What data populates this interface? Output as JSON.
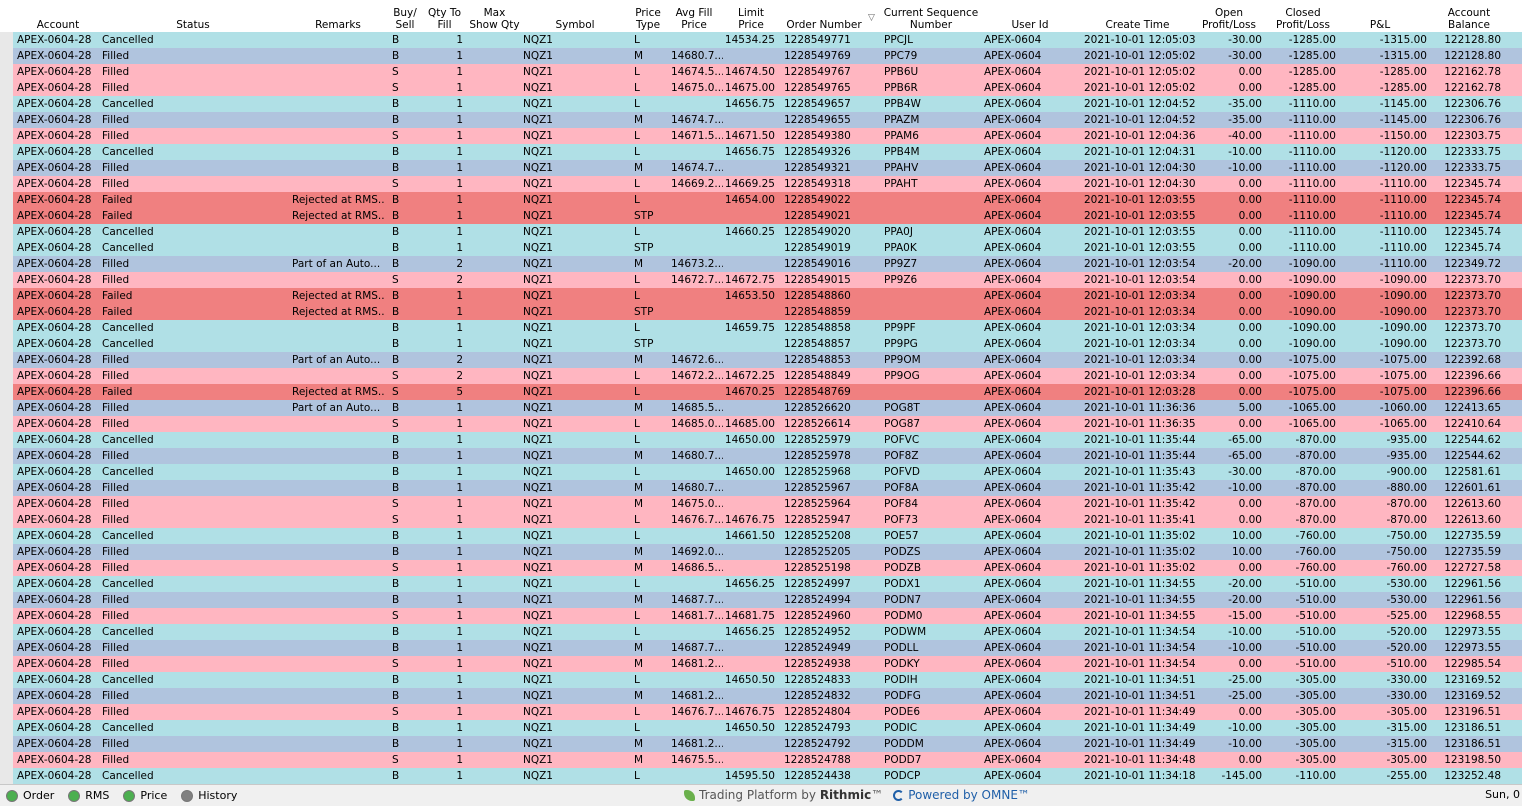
{
  "columns": {
    "account": "Account",
    "status": "Status",
    "remarks": "Remarks",
    "buy_sell": "Buy/\nSell",
    "qty_to_fill": "Qty To\nFill",
    "max_show_qty": "Max\nShow Qty",
    "symbol": "Symbol",
    "price_type": "Price\nType",
    "avg_fill_price": "Avg Fill\nPrice",
    "limit_price": "Limit\nPrice",
    "order_number": "Order Number",
    "current_sequence_number": "Current Sequence\nNumber",
    "user_id": "User Id",
    "create_time": "Create Time",
    "open_pl": "Open\nProfit/Loss",
    "closed_pl": "Closed\nProfit/Loss",
    "pl": "P&L",
    "account_balance": "Account\nBalance"
  },
  "sort_indicator": "▽",
  "rows": [
    [
      "APEX-0604-28",
      "Cancelled",
      "",
      "B",
      "1",
      "NQZ1",
      "L",
      "",
      "14534.25",
      "1228549771",
      "PPCJL",
      "APEX-0604",
      "2021-10-01 12:05:03",
      "-30.00",
      "-1285.00",
      "-1315.00",
      "122128.80"
    ],
    [
      "APEX-0604-28",
      "Filled",
      "",
      "B",
      "1",
      "NQZ1",
      "M",
      "14680.7...",
      "",
      "1228549769",
      "PPC79",
      "APEX-0604",
      "2021-10-01 12:05:02",
      "-30.00",
      "-1285.00",
      "-1315.00",
      "122128.80"
    ],
    [
      "APEX-0604-28",
      "Filled",
      "",
      "S",
      "1",
      "NQZ1",
      "L",
      "14674.5...",
      "14674.50",
      "1228549767",
      "PPB6U",
      "APEX-0604",
      "2021-10-01 12:05:02",
      "0.00",
      "-1285.00",
      "-1285.00",
      "122162.78"
    ],
    [
      "APEX-0604-28",
      "Filled",
      "",
      "S",
      "1",
      "NQZ1",
      "L",
      "14675.0...",
      "14675.00",
      "1228549765",
      "PPB6R",
      "APEX-0604",
      "2021-10-01 12:05:02",
      "0.00",
      "-1285.00",
      "-1285.00",
      "122162.78"
    ],
    [
      "APEX-0604-28",
      "Cancelled",
      "",
      "B",
      "1",
      "NQZ1",
      "L",
      "",
      "14656.75",
      "1228549657",
      "PPB4W",
      "APEX-0604",
      "2021-10-01 12:04:52",
      "-35.00",
      "-1110.00",
      "-1145.00",
      "122306.76"
    ],
    [
      "APEX-0604-28",
      "Filled",
      "",
      "B",
      "1",
      "NQZ1",
      "M",
      "14674.7...",
      "",
      "1228549655",
      "PPAZM",
      "APEX-0604",
      "2021-10-01 12:04:52",
      "-35.00",
      "-1110.00",
      "-1145.00",
      "122306.76"
    ],
    [
      "APEX-0604-28",
      "Filled",
      "",
      "S",
      "1",
      "NQZ1",
      "L",
      "14671.5...",
      "14671.50",
      "1228549380",
      "PPAM6",
      "APEX-0604",
      "2021-10-01 12:04:36",
      "-40.00",
      "-1110.00",
      "-1150.00",
      "122303.75"
    ],
    [
      "APEX-0604-28",
      "Cancelled",
      "",
      "B",
      "1",
      "NQZ1",
      "L",
      "",
      "14656.75",
      "1228549326",
      "PPB4M",
      "APEX-0604",
      "2021-10-01 12:04:31",
      "-10.00",
      "-1110.00",
      "-1120.00",
      "122333.75"
    ],
    [
      "APEX-0604-28",
      "Filled",
      "",
      "B",
      "1",
      "NQZ1",
      "M",
      "14674.7...",
      "",
      "1228549321",
      "PPAHV",
      "APEX-0604",
      "2021-10-01 12:04:30",
      "-10.00",
      "-1110.00",
      "-1120.00",
      "122333.75"
    ],
    [
      "APEX-0604-28",
      "Filled",
      "",
      "S",
      "1",
      "NQZ1",
      "L",
      "14669.2...",
      "14669.25",
      "1228549318",
      "PPAHT",
      "APEX-0604",
      "2021-10-01 12:04:30",
      "0.00",
      "-1110.00",
      "-1110.00",
      "122345.74"
    ],
    [
      "APEX-0604-28",
      "Failed",
      "Rejected at RMS...",
      "B",
      "1",
      "NQZ1",
      "L",
      "",
      "14654.00",
      "1228549022",
      "",
      "APEX-0604",
      "2021-10-01 12:03:55",
      "0.00",
      "-1110.00",
      "-1110.00",
      "122345.74"
    ],
    [
      "APEX-0604-28",
      "Failed",
      "Rejected at RMS...",
      "B",
      "1",
      "NQZ1",
      "STP",
      "",
      "",
      "1228549021",
      "",
      "APEX-0604",
      "2021-10-01 12:03:55",
      "0.00",
      "-1110.00",
      "-1110.00",
      "122345.74"
    ],
    [
      "APEX-0604-28",
      "Cancelled",
      "",
      "B",
      "1",
      "NQZ1",
      "L",
      "",
      "14660.25",
      "1228549020",
      "PPA0J",
      "APEX-0604",
      "2021-10-01 12:03:55",
      "0.00",
      "-1110.00",
      "-1110.00",
      "122345.74"
    ],
    [
      "APEX-0604-28",
      "Cancelled",
      "",
      "B",
      "1",
      "NQZ1",
      "STP",
      "",
      "",
      "1228549019",
      "PPA0K",
      "APEX-0604",
      "2021-10-01 12:03:55",
      "0.00",
      "-1110.00",
      "-1110.00",
      "122345.74"
    ],
    [
      "APEX-0604-28",
      "Filled",
      "Part of an Auto...",
      "B",
      "2",
      "NQZ1",
      "M",
      "14673.2...",
      "",
      "1228549016",
      "PP9Z7",
      "APEX-0604",
      "2021-10-01 12:03:54",
      "-20.00",
      "-1090.00",
      "-1110.00",
      "122349.72"
    ],
    [
      "APEX-0604-28",
      "Filled",
      "",
      "S",
      "2",
      "NQZ1",
      "L",
      "14672.7...",
      "14672.75",
      "1228549015",
      "PP9Z6",
      "APEX-0604",
      "2021-10-01 12:03:54",
      "0.00",
      "-1090.00",
      "-1090.00",
      "122373.70"
    ],
    [
      "APEX-0604-28",
      "Failed",
      "Rejected at RMS...",
      "B",
      "1",
      "NQZ1",
      "L",
      "",
      "14653.50",
      "1228548860",
      "",
      "APEX-0604",
      "2021-10-01 12:03:34",
      "0.00",
      "-1090.00",
      "-1090.00",
      "122373.70"
    ],
    [
      "APEX-0604-28",
      "Failed",
      "Rejected at RMS...",
      "B",
      "1",
      "NQZ1",
      "STP",
      "",
      "",
      "1228548859",
      "",
      "APEX-0604",
      "2021-10-01 12:03:34",
      "0.00",
      "-1090.00",
      "-1090.00",
      "122373.70"
    ],
    [
      "APEX-0604-28",
      "Cancelled",
      "",
      "B",
      "1",
      "NQZ1",
      "L",
      "",
      "14659.75",
      "1228548858",
      "PP9PF",
      "APEX-0604",
      "2021-10-01 12:03:34",
      "0.00",
      "-1090.00",
      "-1090.00",
      "122373.70"
    ],
    [
      "APEX-0604-28",
      "Cancelled",
      "",
      "B",
      "1",
      "NQZ1",
      "STP",
      "",
      "",
      "1228548857",
      "PP9PG",
      "APEX-0604",
      "2021-10-01 12:03:34",
      "0.00",
      "-1090.00",
      "-1090.00",
      "122373.70"
    ],
    [
      "APEX-0604-28",
      "Filled",
      "Part of an Auto...",
      "B",
      "2",
      "NQZ1",
      "M",
      "14672.6...",
      "",
      "1228548853",
      "PP9OM",
      "APEX-0604",
      "2021-10-01 12:03:34",
      "0.00",
      "-1075.00",
      "-1075.00",
      "122392.68"
    ],
    [
      "APEX-0604-28",
      "Filled",
      "",
      "S",
      "2",
      "NQZ1",
      "L",
      "14672.2...",
      "14672.25",
      "1228548849",
      "PP9OG",
      "APEX-0604",
      "2021-10-01 12:03:34",
      "0.00",
      "-1075.00",
      "-1075.00",
      "122396.66"
    ],
    [
      "APEX-0604-28",
      "Failed",
      "Rejected at RMS...",
      "S",
      "5",
      "NQZ1",
      "L",
      "",
      "14670.25",
      "1228548769",
      "",
      "APEX-0604",
      "2021-10-01 12:03:28",
      "0.00",
      "-1075.00",
      "-1075.00",
      "122396.66"
    ],
    [
      "APEX-0604-28",
      "Filled",
      "Part of an Auto...",
      "B",
      "1",
      "NQZ1",
      "M",
      "14685.5...",
      "",
      "1228526620",
      "POG8T",
      "APEX-0604",
      "2021-10-01 11:36:36",
      "5.00",
      "-1065.00",
      "-1060.00",
      "122413.65"
    ],
    [
      "APEX-0604-28",
      "Filled",
      "",
      "S",
      "1",
      "NQZ1",
      "L",
      "14685.0...",
      "14685.00",
      "1228526614",
      "POG87",
      "APEX-0604",
      "2021-10-01 11:36:35",
      "0.00",
      "-1065.00",
      "-1065.00",
      "122410.64"
    ],
    [
      "APEX-0604-28",
      "Cancelled",
      "",
      "B",
      "1",
      "NQZ1",
      "L",
      "",
      "14650.00",
      "1228525979",
      "POFVC",
      "APEX-0604",
      "2021-10-01 11:35:44",
      "-65.00",
      "-870.00",
      "-935.00",
      "122544.62"
    ],
    [
      "APEX-0604-28",
      "Filled",
      "",
      "B",
      "1",
      "NQZ1",
      "M",
      "14680.7...",
      "",
      "1228525978",
      "POF8Z",
      "APEX-0604",
      "2021-10-01 11:35:44",
      "-65.00",
      "-870.00",
      "-935.00",
      "122544.62"
    ],
    [
      "APEX-0604-28",
      "Cancelled",
      "",
      "B",
      "1",
      "NQZ1",
      "L",
      "",
      "14650.00",
      "1228525968",
      "POFVD",
      "APEX-0604",
      "2021-10-01 11:35:43",
      "-30.00",
      "-870.00",
      "-900.00",
      "122581.61"
    ],
    [
      "APEX-0604-28",
      "Filled",
      "",
      "B",
      "1",
      "NQZ1",
      "M",
      "14680.7...",
      "",
      "1228525967",
      "POF8A",
      "APEX-0604",
      "2021-10-01 11:35:42",
      "-10.00",
      "-870.00",
      "-880.00",
      "122601.61"
    ],
    [
      "APEX-0604-28",
      "Filled",
      "",
      "S",
      "1",
      "NQZ1",
      "M",
      "14675.0...",
      "",
      "1228525964",
      "POF84",
      "APEX-0604",
      "2021-10-01 11:35:42",
      "0.00",
      "-870.00",
      "-870.00",
      "122613.60"
    ],
    [
      "APEX-0604-28",
      "Filled",
      "",
      "S",
      "1",
      "NQZ1",
      "L",
      "14676.7...",
      "14676.75",
      "1228525947",
      "POF73",
      "APEX-0604",
      "2021-10-01 11:35:41",
      "0.00",
      "-870.00",
      "-870.00",
      "122613.60"
    ],
    [
      "APEX-0604-28",
      "Cancelled",
      "",
      "B",
      "1",
      "NQZ1",
      "L",
      "",
      "14661.50",
      "1228525208",
      "POE57",
      "APEX-0604",
      "2021-10-01 11:35:02",
      "10.00",
      "-760.00",
      "-750.00",
      "122735.59"
    ],
    [
      "APEX-0604-28",
      "Filled",
      "",
      "B",
      "1",
      "NQZ1",
      "M",
      "14692.0...",
      "",
      "1228525205",
      "PODZS",
      "APEX-0604",
      "2021-10-01 11:35:02",
      "10.00",
      "-760.00",
      "-750.00",
      "122735.59"
    ],
    [
      "APEX-0604-28",
      "Filled",
      "",
      "S",
      "1",
      "NQZ1",
      "M",
      "14686.5...",
      "",
      "1228525198",
      "PODZB",
      "APEX-0604",
      "2021-10-01 11:35:02",
      "0.00",
      "-760.00",
      "-760.00",
      "122727.58"
    ],
    [
      "APEX-0604-28",
      "Cancelled",
      "",
      "B",
      "1",
      "NQZ1",
      "L",
      "",
      "14656.25",
      "1228524997",
      "PODX1",
      "APEX-0604",
      "2021-10-01 11:34:55",
      "-20.00",
      "-510.00",
      "-530.00",
      "122961.56"
    ],
    [
      "APEX-0604-28",
      "Filled",
      "",
      "B",
      "1",
      "NQZ1",
      "M",
      "14687.7...",
      "",
      "1228524994",
      "PODN7",
      "APEX-0604",
      "2021-10-01 11:34:55",
      "-20.00",
      "-510.00",
      "-530.00",
      "122961.56"
    ],
    [
      "APEX-0604-28",
      "Filled",
      "",
      "S",
      "1",
      "NQZ1",
      "L",
      "14681.7...",
      "14681.75",
      "1228524960",
      "PODM0",
      "APEX-0604",
      "2021-10-01 11:34:55",
      "-15.00",
      "-510.00",
      "-525.00",
      "122968.55"
    ],
    [
      "APEX-0604-28",
      "Cancelled",
      "",
      "B",
      "1",
      "NQZ1",
      "L",
      "",
      "14656.25",
      "1228524952",
      "PODWM",
      "APEX-0604",
      "2021-10-01 11:34:54",
      "-10.00",
      "-510.00",
      "-520.00",
      "122973.55"
    ],
    [
      "APEX-0604-28",
      "Filled",
      "",
      "B",
      "1",
      "NQZ1",
      "M",
      "14687.7...",
      "",
      "1228524949",
      "PODLL",
      "APEX-0604",
      "2021-10-01 11:34:54",
      "-10.00",
      "-510.00",
      "-520.00",
      "122973.55"
    ],
    [
      "APEX-0604-28",
      "Filled",
      "",
      "S",
      "1",
      "NQZ1",
      "M",
      "14681.2...",
      "",
      "1228524938",
      "PODKY",
      "APEX-0604",
      "2021-10-01 11:34:54",
      "0.00",
      "-510.00",
      "-510.00",
      "122985.54"
    ],
    [
      "APEX-0604-28",
      "Cancelled",
      "",
      "B",
      "1",
      "NQZ1",
      "L",
      "",
      "14650.50",
      "1228524833",
      "PODIH",
      "APEX-0604",
      "2021-10-01 11:34:51",
      "-25.00",
      "-305.00",
      "-330.00",
      "123169.52"
    ],
    [
      "APEX-0604-28",
      "Filled",
      "",
      "B",
      "1",
      "NQZ1",
      "M",
      "14681.2...",
      "",
      "1228524832",
      "PODFG",
      "APEX-0604",
      "2021-10-01 11:34:51",
      "-25.00",
      "-305.00",
      "-330.00",
      "123169.52"
    ],
    [
      "APEX-0604-28",
      "Filled",
      "",
      "S",
      "1",
      "NQZ1",
      "L",
      "14676.7...",
      "14676.75",
      "1228524804",
      "PODE6",
      "APEX-0604",
      "2021-10-01 11:34:49",
      "0.00",
      "-305.00",
      "-305.00",
      "123196.51"
    ],
    [
      "APEX-0604-28",
      "Cancelled",
      "",
      "B",
      "1",
      "NQZ1",
      "L",
      "",
      "14650.50",
      "1228524793",
      "PODIC",
      "APEX-0604",
      "2021-10-01 11:34:49",
      "-10.00",
      "-305.00",
      "-315.00",
      "123186.51"
    ],
    [
      "APEX-0604-28",
      "Filled",
      "",
      "B",
      "1",
      "NQZ1",
      "M",
      "14681.2...",
      "",
      "1228524792",
      "PODDM",
      "APEX-0604",
      "2021-10-01 11:34:49",
      "-10.00",
      "-305.00",
      "-315.00",
      "123186.51"
    ],
    [
      "APEX-0604-28",
      "Filled",
      "",
      "S",
      "1",
      "NQZ1",
      "M",
      "14675.5...",
      "",
      "1228524788",
      "PODD7",
      "APEX-0604",
      "2021-10-01 11:34:48",
      "0.00",
      "-305.00",
      "-305.00",
      "123198.50"
    ],
    [
      "APEX-0604-28",
      "Cancelled",
      "",
      "B",
      "1",
      "NQZ1",
      "L",
      "",
      "14595.50",
      "1228524438",
      "PODCP",
      "APEX-0604",
      "2021-10-01 11:34:18",
      "-145.00",
      "-110.00",
      "-255.00",
      "123252.48"
    ]
  ],
  "status_colors": {
    "cancelled": "#b0e0e6",
    "filled_buy": "#b0c4de",
    "filled_sell": "#ffb6c1",
    "failed": "#f08080"
  },
  "statusbar": {
    "items": [
      {
        "label": "Order",
        "led_color": "#4caf50",
        "icon": "status-led-icon"
      },
      {
        "label": "RMS",
        "led_color": "#4caf50",
        "icon": "status-led-icon"
      },
      {
        "label": "Price",
        "led_color": "#4caf50",
        "icon": "status-led-icon"
      },
      {
        "label": "History",
        "led_color": "#808080",
        "icon": "status-led-icon"
      }
    ],
    "brand_prefix": "Trading Platform by",
    "brand_name": "Rithmic",
    "brand_tm": "™",
    "omne_text": "Powered by OMNE™",
    "right_text": "Sun, 0"
  }
}
